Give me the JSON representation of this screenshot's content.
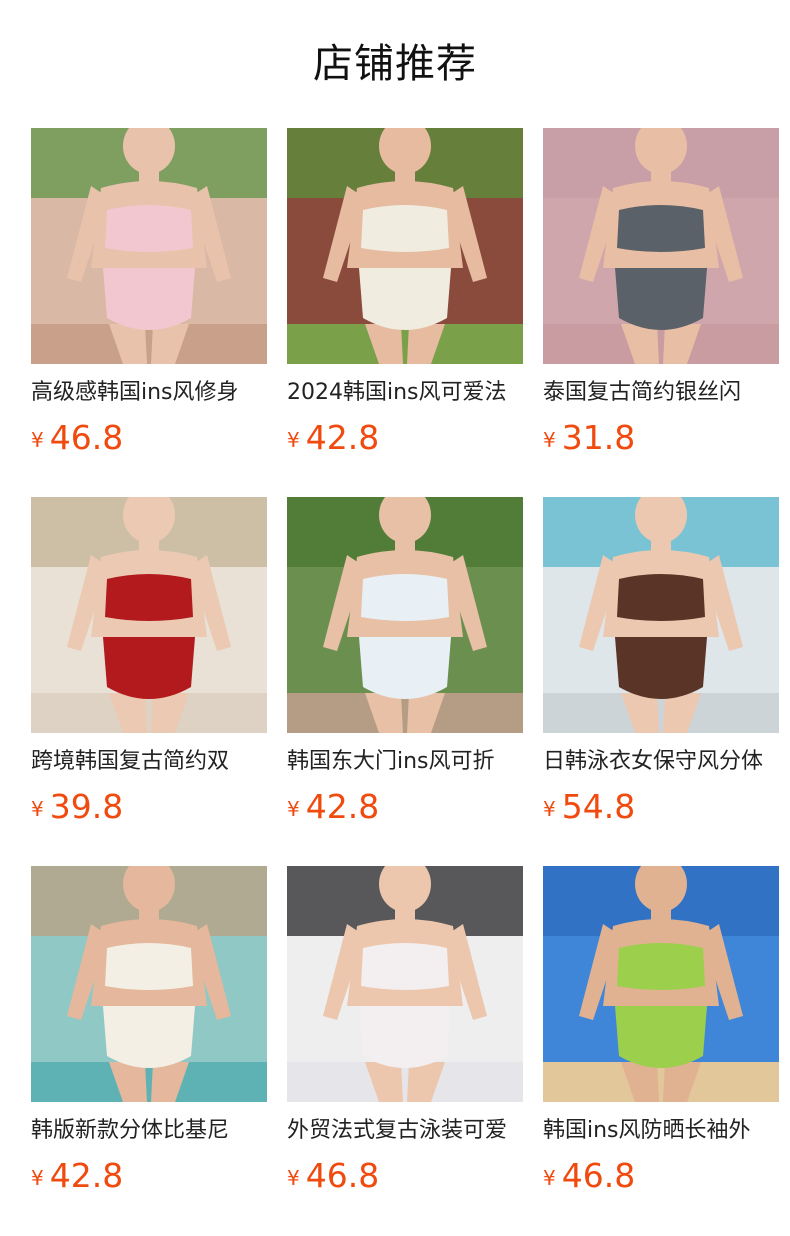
{
  "section": {
    "title": "店铺推荐"
  },
  "products": [
    {
      "name": "高级感韩国ins风修身",
      "currency": "¥",
      "price": "46.8",
      "image": {
        "bg": "#d9b8a6",
        "top": "#6f9a55",
        "garment": "#f2c7d0",
        "skin": "#e9c2ab",
        "ground": "#c9a08a"
      }
    },
    {
      "name": "2024韩国ins风可爱法",
      "currency": "¥",
      "price": "42.8",
      "image": {
        "bg": "#8a4a3c",
        "top": "#5f8a3c",
        "garment": "#f1ece0",
        "skin": "#e6bba0",
        "ground": "#7aa04a"
      }
    },
    {
      "name": "泰国复古简约银丝闪",
      "currency": "¥",
      "price": "31.8",
      "image": {
        "bg": "#cfa6ac",
        "top": "#c79ea4",
        "garment": "#5b6168",
        "skin": "#e8bea5",
        "ground": "#c89ca1"
      }
    },
    {
      "name": "跨境韩国复古简约双",
      "currency": "¥",
      "price": "39.8",
      "image": {
        "bg": "#e9e1d6",
        "top": "#c8b89e",
        "garment": "#b21a1e",
        "skin": "#ecc9b2",
        "ground": "#ddd2c3"
      }
    },
    {
      "name": "韩国东大门ins风可折",
      "currency": "¥",
      "price": "42.8",
      "image": {
        "bg": "#6a8f4e",
        "top": "#4c7a36",
        "garment": "#e8f0f6",
        "skin": "#e8c0a5",
        "ground": "#b59c85"
      }
    },
    {
      "name": "日韩泳衣女保守风分体",
      "currency": "¥",
      "price": "54.8",
      "image": {
        "bg": "#dfe6ea",
        "top": "#69bcd0",
        "garment": "#5a3426",
        "skin": "#ecc8b0",
        "ground": "#cdd4d8"
      }
    },
    {
      "name": "韩版新款分体比基尼",
      "currency": "¥",
      "price": "42.8",
      "image": {
        "bg": "#8fc8c4",
        "top": "#b6a58a",
        "garment": "#f4efe4",
        "skin": "#e5b79c",
        "ground": "#5fb2b3"
      }
    },
    {
      "name": "外贸法式复古泳装可爱",
      "currency": "¥",
      "price": "46.8",
      "image": {
        "bg": "#eeeeee",
        "top": "#3d3d3f",
        "garment": "#f3eef0",
        "skin": "#ecc7ad",
        "ground": "#e6e6ea"
      }
    },
    {
      "name": "韩国ins风防晒长袖外",
      "currency": "¥",
      "price": "46.8",
      "image": {
        "bg": "#3f86d8",
        "top": "#2f6fc2",
        "garment": "#9ccf4c",
        "skin": "#e0b291",
        "ground": "#e2c79a"
      }
    }
  ]
}
